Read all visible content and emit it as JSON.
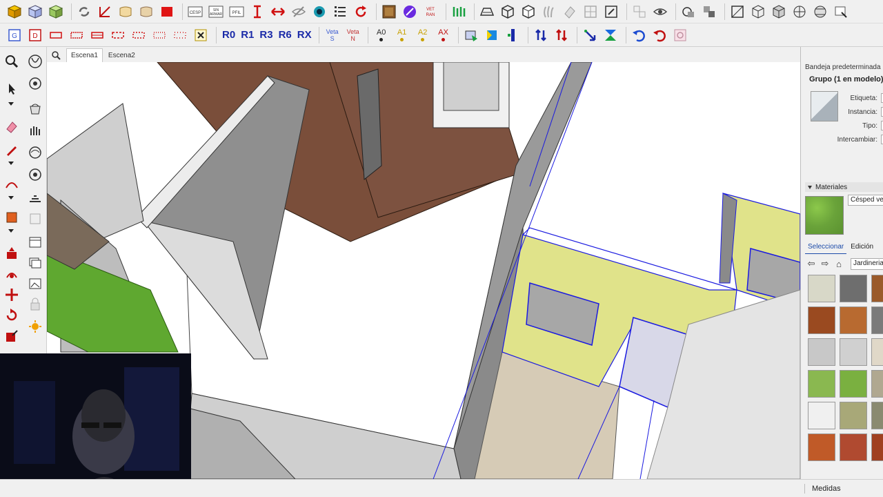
{
  "scenes": {
    "tabs": [
      {
        "label": "Escena1",
        "active": true
      },
      {
        "label": "Escena2",
        "active": false
      }
    ]
  },
  "toolbar_row2": {
    "rotations": [
      "R0",
      "R1",
      "R3",
      "R6",
      "RX"
    ],
    "veta_s": {
      "top": "Veta",
      "bottom": "S"
    },
    "veta_n": {
      "top": "Veta",
      "bottom": "N"
    },
    "angles": [
      {
        "label": "A0",
        "color": "#2b2b2b"
      },
      {
        "label": "A1",
        "color": "#c8a000"
      },
      {
        "label": "A2",
        "color": "#c8a000"
      },
      {
        "label": "AX",
        "color": "#c01010"
      }
    ]
  },
  "toolbar_row1": {
    "icons": [
      "cube-yellow-icon",
      "cube-blue-icon",
      "cube-green-icon",
      "refresh-icon",
      "dimension-icon",
      "paper-icon",
      "paper-alt-icon",
      "red-square-icon",
      "cesp-icon",
      "sin-armar-icon",
      "perfil-icon",
      "vertical-dimension-icon",
      "horizontal-dimension-icon",
      "hide-icon",
      "target-icon",
      "list-icon",
      "redo-icon",
      "texture-icon",
      "purple-circle-icon",
      "veta-icon",
      "green-grid-icon",
      "tray-icon",
      "cube-outline-icon",
      "cube-open-icon",
      "hand-icon",
      "eraser-gray-icon",
      "section-icon",
      "edit-icon",
      "stack-icon",
      "eye-icon",
      "group-icon",
      "components-icon",
      "box-icon",
      "box-corner-icon",
      "box-3d-icon",
      "sphere-icon",
      "sphere-alt-icon",
      "tray-settings-icon"
    ]
  },
  "right_panel": {
    "tray_title": "Bandeja predeterminada",
    "entity_info": "Grupo (1 en modelo)",
    "labels": {
      "etiqueta": "Etiqueta:",
      "instancia": "Instancia:",
      "tipo": "Tipo:",
      "intercambiar": "Intercambiar:"
    },
    "materials_section": "Materiales",
    "material_name": "Césped ver",
    "tabs": {
      "select": "Seleccionar",
      "edit": "Edición"
    },
    "library": "Jardineria",
    "swatch_colors": [
      [
        "#d8d8c8",
        "#6e6e6e",
        "#9a5a2a"
      ],
      [
        "#9a4a20",
        "#b86a30",
        "#7a7a7a"
      ],
      [
        "#c8c8c8",
        "#d0d0d0",
        "#e0d8c8"
      ],
      [
        "#8ab850",
        "#7ab040",
        "#b0a890"
      ],
      [
        "#f0f0f0",
        "#a8a878",
        "#8a8a70"
      ],
      [
        "#c05a28",
        "#b04a30",
        "#a04020"
      ]
    ]
  },
  "status": {
    "measures": "Medidas"
  }
}
